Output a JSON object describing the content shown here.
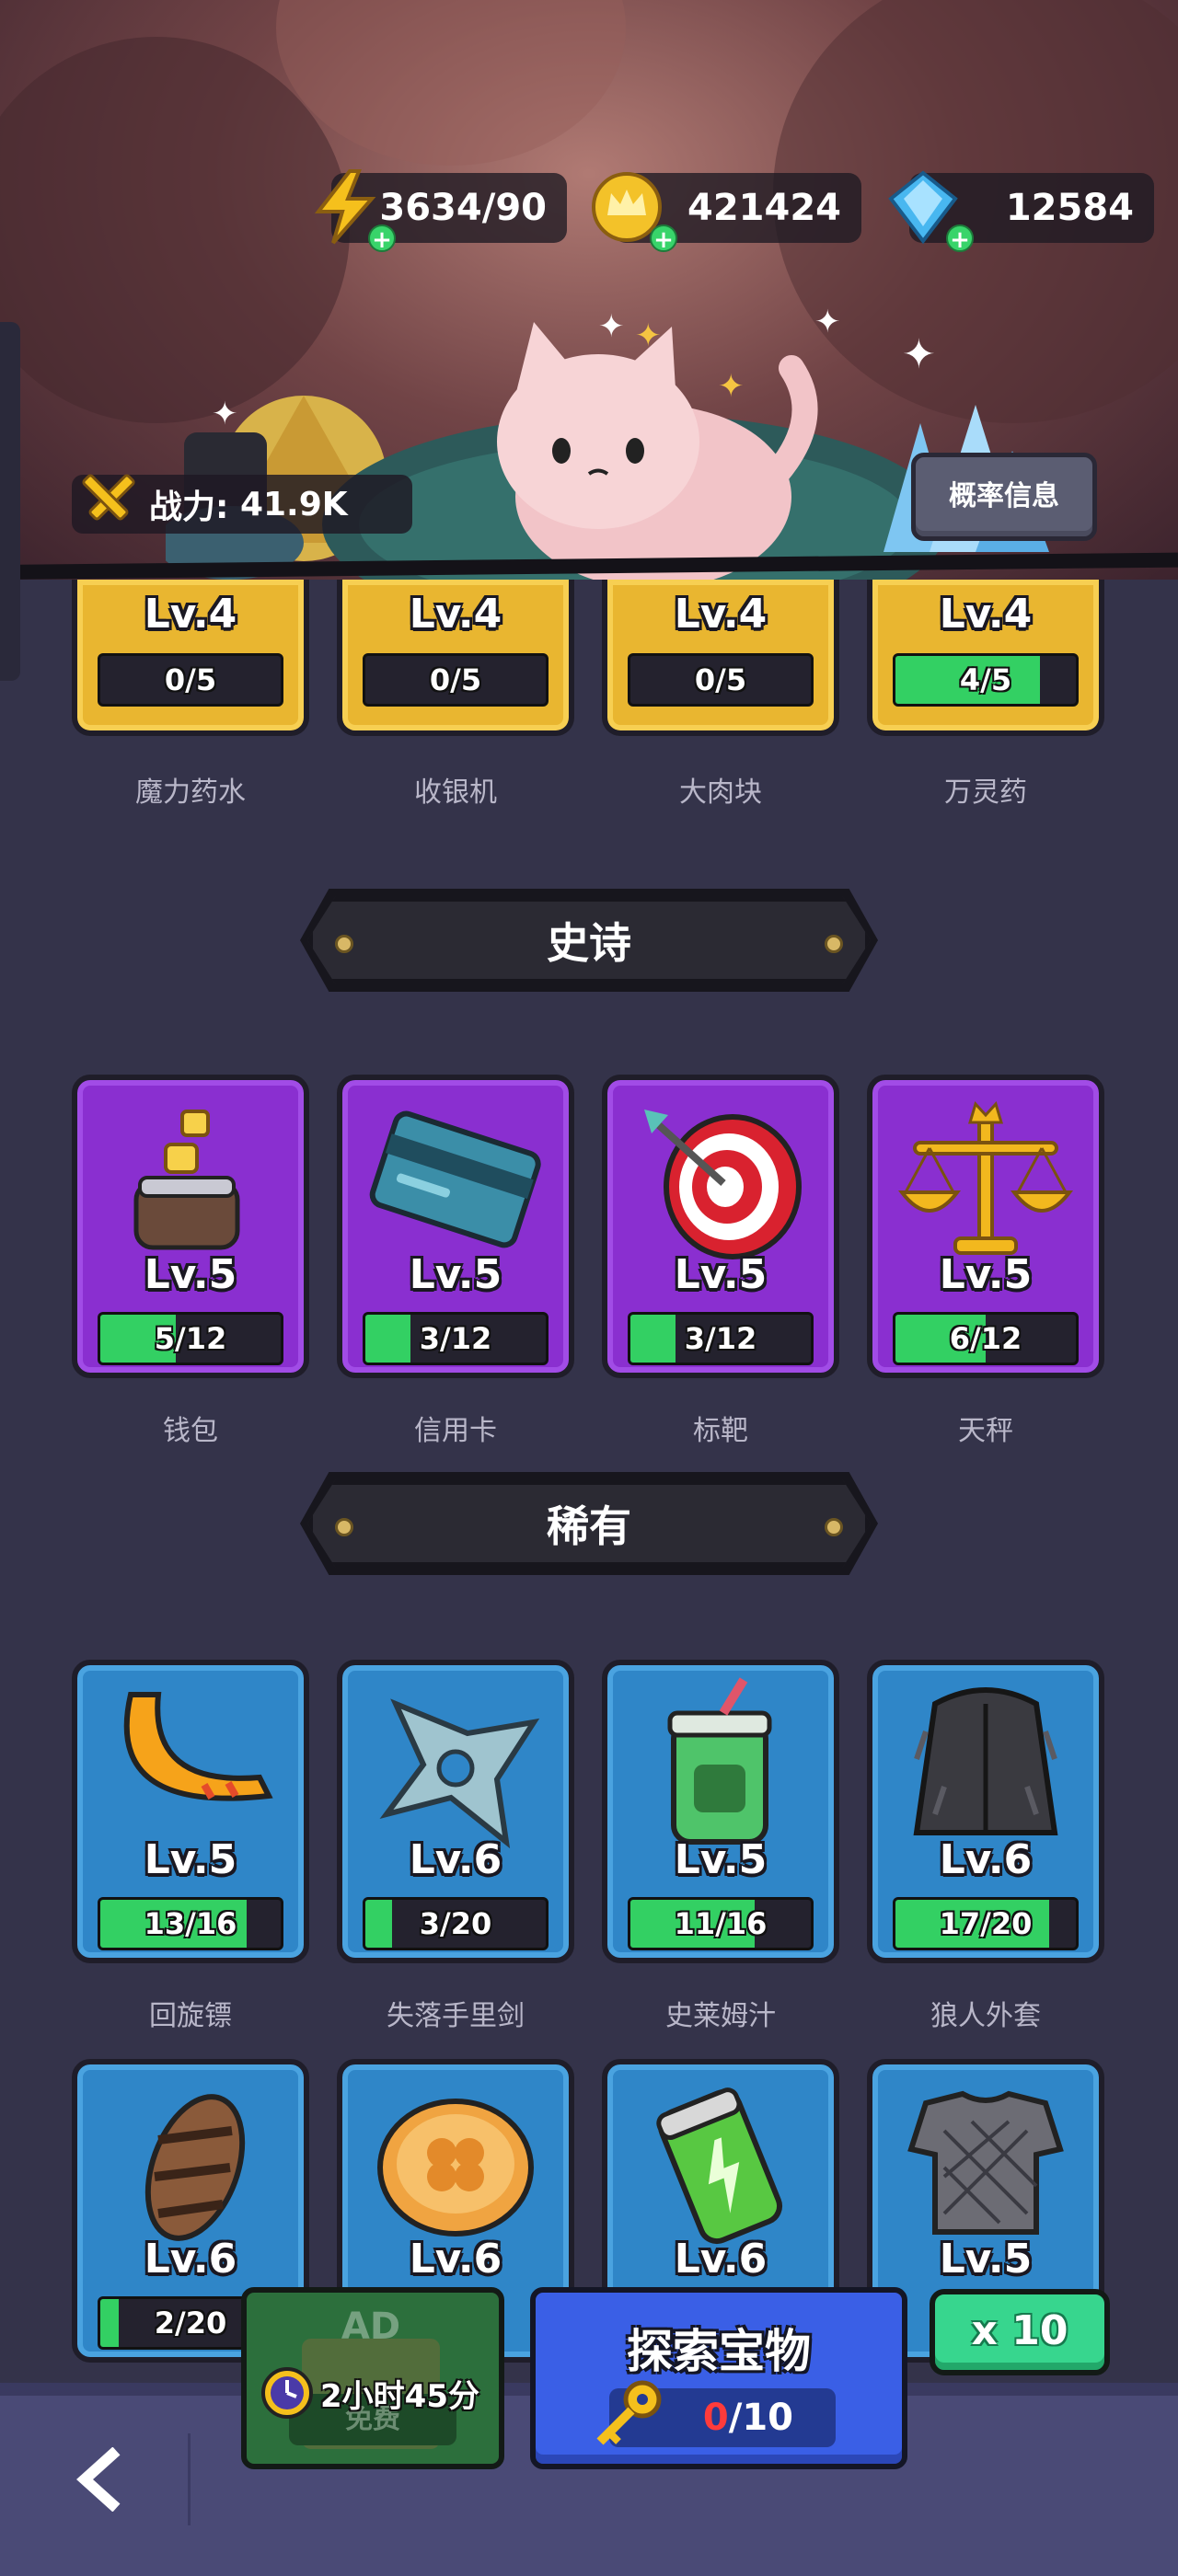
{
  "resources": {
    "energy": "3634/90",
    "gold": "421424",
    "gems": "12584"
  },
  "power": {
    "label": "战力:",
    "value": "41.9K"
  },
  "probability_button": "概率信息",
  "legendary_cards": [
    {
      "name": "魔力药水",
      "level": "Lv.4",
      "progress": "0/5",
      "fraction": 0
    },
    {
      "name": "收银机",
      "level": "Lv.4",
      "progress": "0/5",
      "fraction": 0
    },
    {
      "name": "大肉块",
      "level": "Lv.4",
      "progress": "0/5",
      "fraction": 0
    },
    {
      "name": "万灵药",
      "level": "Lv.4",
      "progress": "4/5",
      "fraction": 0.8
    }
  ],
  "sections": {
    "epic": "史诗",
    "rare": "稀有"
  },
  "epic_cards": [
    {
      "name": "钱包",
      "level": "Lv.5",
      "progress": "5/12",
      "fraction": 0.42
    },
    {
      "name": "信用卡",
      "level": "Lv.5",
      "progress": "3/12",
      "fraction": 0.25
    },
    {
      "name": "标靶",
      "level": "Lv.5",
      "progress": "3/12",
      "fraction": 0.25
    },
    {
      "name": "天秤",
      "level": "Lv.5",
      "progress": "6/12",
      "fraction": 0.5
    }
  ],
  "rare_cards_row1": [
    {
      "name": "回旋镖",
      "level": "Lv.5",
      "progress": "13/16",
      "fraction": 0.81
    },
    {
      "name": "失落手里剑",
      "level": "Lv.6",
      "progress": "3/20",
      "fraction": 0.15
    },
    {
      "name": "史莱姆汁",
      "level": "Lv.5",
      "progress": "11/16",
      "fraction": 0.69
    },
    {
      "name": "狼人外套",
      "level": "Lv.6",
      "progress": "17/20",
      "fraction": 0.85
    }
  ],
  "rare_cards_row2": [
    {
      "level": "Lv.6",
      "progress": "2/20",
      "fraction": 0.1
    },
    {
      "level": "Lv.6"
    },
    {
      "level": "Lv.6"
    },
    {
      "level": "Lv.5"
    }
  ],
  "bottom": {
    "ad_timer": "2小时45分",
    "ad_free": "免费",
    "explore_title": "探索宝物",
    "keys_current": "0",
    "keys_total": "/10",
    "multi": "x 10"
  },
  "colors": {
    "legendary": "#e9b630",
    "epic": "#8a2fd0",
    "rare": "#2f86c8",
    "progress_fill": "#33d063",
    "explore_button": "#3a5fe6",
    "x10_button": "#37d68e"
  }
}
